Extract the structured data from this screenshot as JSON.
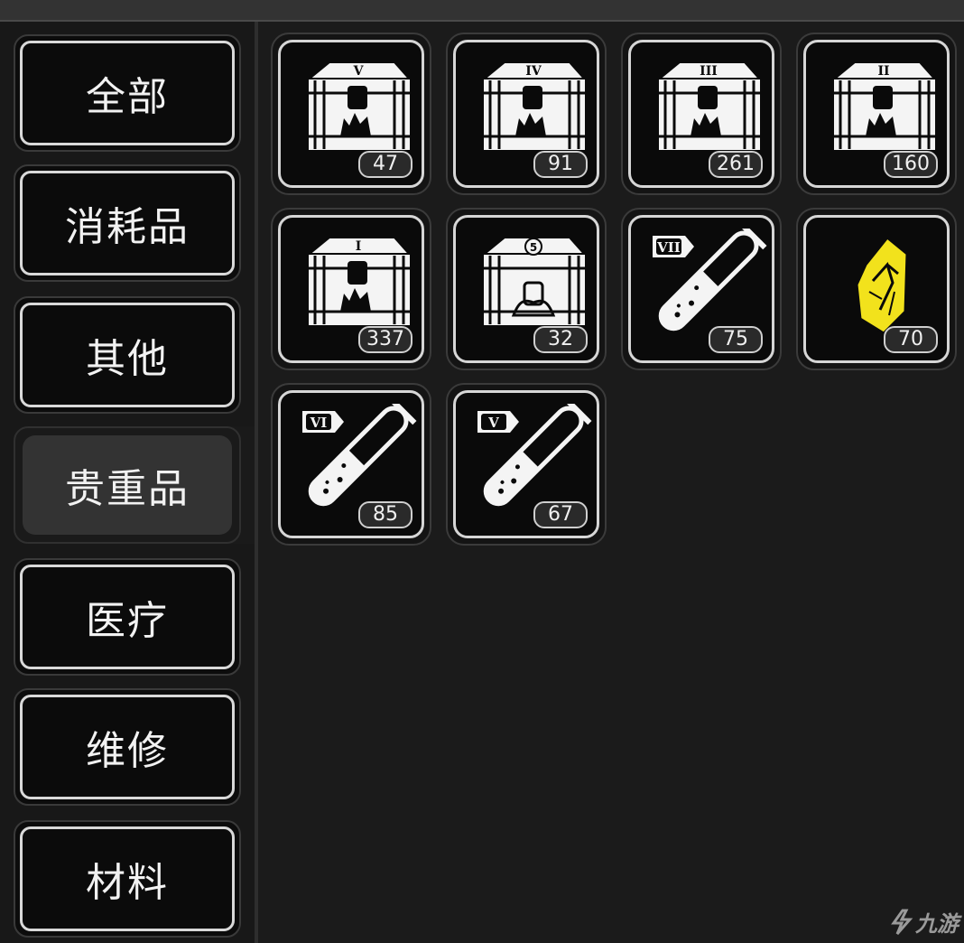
{
  "sidebar": {
    "tabs": [
      {
        "label": "全部",
        "selected": false
      },
      {
        "label": "消耗品",
        "selected": false
      },
      {
        "label": "其他",
        "selected": false
      },
      {
        "label": "贵重品",
        "selected": true
      },
      {
        "label": "医疗",
        "selected": false
      },
      {
        "label": "维修",
        "selected": false
      },
      {
        "label": "材料",
        "selected": false
      }
    ]
  },
  "inventory": {
    "items": [
      {
        "icon": "supply-crate-icon",
        "tier": "V",
        "count": "47"
      },
      {
        "icon": "supply-crate-icon",
        "tier": "IV",
        "count": "91"
      },
      {
        "icon": "supply-crate-icon",
        "tier": "III",
        "count": "261"
      },
      {
        "icon": "supply-crate-icon",
        "tier": "II",
        "count": "160"
      },
      {
        "icon": "supply-crate-icon",
        "tier": "I",
        "count": "337"
      },
      {
        "icon": "special-crate-icon",
        "tier": "5",
        "count": "32"
      },
      {
        "icon": "test-tube-icon",
        "tier": "VII",
        "count": "75"
      },
      {
        "icon": "crystal-icon",
        "tier": "",
        "count": "70",
        "color": "#f2e21c"
      },
      {
        "icon": "test-tube-icon",
        "tier": "VI",
        "count": "85"
      },
      {
        "icon": "test-tube-icon",
        "tier": "V",
        "count": "67"
      }
    ]
  },
  "watermark": {
    "text": "九游"
  }
}
